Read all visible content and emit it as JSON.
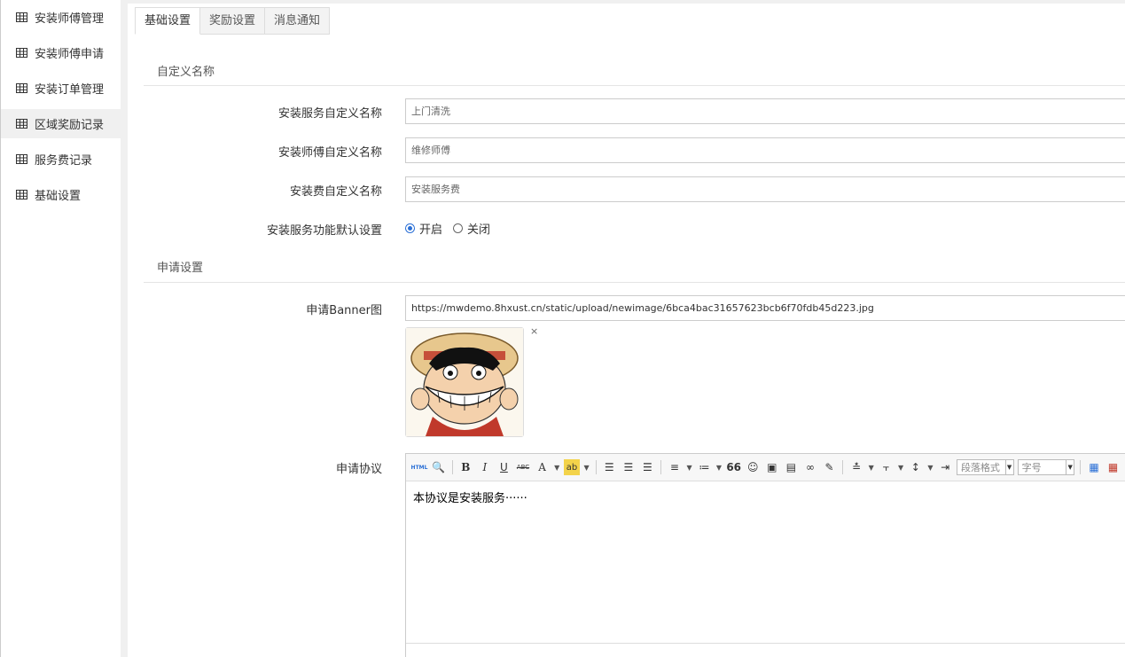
{
  "sidebar": {
    "items": [
      {
        "label": "安装师傅管理",
        "icon": "table-icon"
      },
      {
        "label": "安装师傅申请",
        "icon": "table-icon"
      },
      {
        "label": "安装订单管理",
        "icon": "table-icon"
      },
      {
        "label": "区域奖励记录",
        "icon": "table-icon",
        "active": true
      },
      {
        "label": "服务费记录",
        "icon": "table-icon"
      },
      {
        "label": "基础设置",
        "icon": "table-icon"
      }
    ]
  },
  "tabs": [
    {
      "label": "基础设置",
      "active": true
    },
    {
      "label": "奖励设置"
    },
    {
      "label": "消息通知"
    }
  ],
  "sections": {
    "custom_name": "自定义名称",
    "apply": "申请设置"
  },
  "fields": {
    "service_name": {
      "label": "安装服务自定义名称",
      "value": "上门清洗"
    },
    "worker_name": {
      "label": "安装师傅自定义名称",
      "value": "维修师傅"
    },
    "fee_name": {
      "label": "安装费自定义名称",
      "value": "安装服务费"
    },
    "default_switch": {
      "label": "安装服务功能默认设置",
      "on_label": "开启",
      "off_label": "关闭",
      "selected": "开启"
    },
    "banner": {
      "label": "申请Banner图",
      "value": "https://mwdemo.8hxust.cn/static/upload/newimage/6bca4bac31657623bcb6f70fdb45d223.jpg",
      "close": "×"
    },
    "agreement": {
      "label": "申请协议",
      "content": "本协议是安装服务······"
    }
  },
  "toolbar": {
    "html": "HTML",
    "bold": "B",
    "italic": "I",
    "underline": "U",
    "strike": "ABC",
    "font_color": "A",
    "highlight": "ab",
    "quote": "66",
    "paragraph_select": "段落格式",
    "size_select": "字号"
  },
  "colors": {
    "accent": "#2a6fd6"
  }
}
